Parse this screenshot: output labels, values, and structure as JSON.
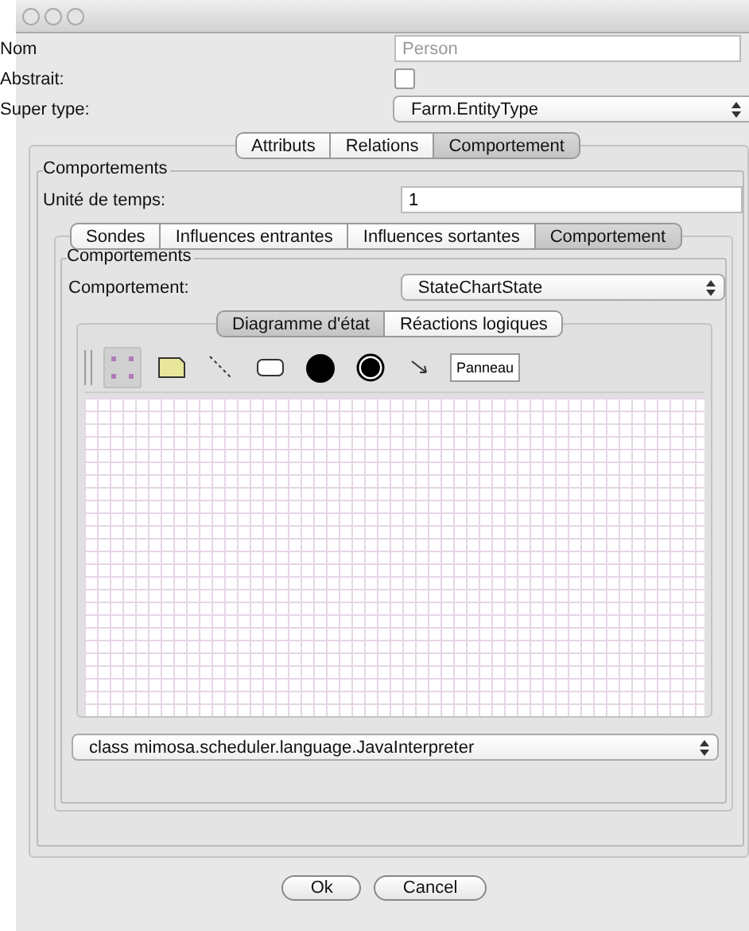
{
  "form": [
    {
      "label": "Nom",
      "kind": "text",
      "placeholder": "Person"
    },
    {
      "label": "Abstrait:",
      "kind": "checkbox",
      "checked": false
    },
    {
      "label": "Super type:",
      "kind": "select",
      "value": "Farm.EntityType"
    }
  ],
  "tabs": [
    {
      "label": "Attributs",
      "selected": false
    },
    {
      "label": "Relations",
      "selected": false
    },
    {
      "label": "Comportement",
      "selected": true
    }
  ],
  "group": {
    "title": "Comportements",
    "time_label": "Unité de temps:",
    "time_value": "1"
  },
  "inner_tabs": [
    {
      "label": "Sondes",
      "selected": false
    },
    {
      "label": "Influences entrantes",
      "selected": false
    },
    {
      "label": "Influences sortantes",
      "selected": false
    },
    {
      "label": "Comportement",
      "selected": true
    }
  ],
  "inner_group": {
    "title": "Comportements",
    "behaviour_label": "Comportement:",
    "behaviour_value": "StateChartState"
  },
  "diagram_tabs": [
    {
      "label": "Diagramme d'état",
      "selected": true
    },
    {
      "label": "Réactions logiques",
      "selected": false
    }
  ],
  "tools": [
    {
      "kind": "select",
      "selected": true
    },
    {
      "kind": "note",
      "selected": false
    },
    {
      "kind": "line",
      "selected": false
    },
    {
      "kind": "state",
      "selected": false
    },
    {
      "kind": "initial",
      "selected": false
    },
    {
      "kind": "final",
      "selected": false
    },
    {
      "kind": "transition",
      "selected": false
    },
    {
      "kind": "panel",
      "label": "Panneau",
      "selected": false
    }
  ],
  "interpreter": "class mimosa.scheduler.language.JavaInterpreter",
  "buttons": [
    "Ok",
    "Cancel"
  ]
}
